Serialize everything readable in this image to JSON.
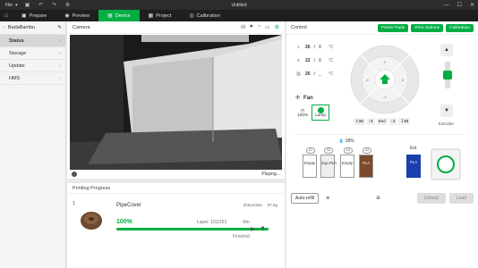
{
  "titlebar": {
    "file_label": "File",
    "window_title": "Untitled"
  },
  "nav": {
    "tabs": [
      {
        "label": "Prepare",
        "active": false
      },
      {
        "label": "Preview",
        "active": false
      },
      {
        "label": "Device",
        "active": true
      },
      {
        "label": "Project",
        "active": false
      },
      {
        "label": "Calibration",
        "active": false
      }
    ]
  },
  "sidebar": {
    "printer_name": "BadaBambu",
    "items": [
      {
        "label": "Status",
        "active": true
      },
      {
        "label": "Storage",
        "active": false
      },
      {
        "label": "Update",
        "active": false
      },
      {
        "label": "HMS",
        "active": false
      }
    ]
  },
  "camera": {
    "title": "Camera",
    "status": "Playing..."
  },
  "progress": {
    "title": "Printing Progress",
    "plate_number": "1",
    "job_name": "PipeCover",
    "time": "2h51m54s",
    "weight": "97.6g",
    "percent_label": "100%",
    "percent_value": 100,
    "layer": "Layer: 151/151",
    "remaining": "-0m",
    "state": "Finished"
  },
  "control": {
    "title": "Control",
    "buttons": [
      "Printer Parts",
      "Print Options",
      "Calibration"
    ],
    "temps": [
      {
        "current": "26",
        "target": "0",
        "unit": "°C"
      },
      {
        "current": "22",
        "target": "0",
        "unit": "°C"
      },
      {
        "current": "26",
        "target": "_",
        "unit": "°C"
      }
    ],
    "fan_label": "Fan",
    "speed_label": "100%",
    "lamp_label": "Lamp",
    "dpad": {
      "up": "Y",
      "down": "-Y",
      "left": "-X",
      "right": "X"
    },
    "z_steps": [
      "10",
      "1",
      "Bed",
      "1",
      "10"
    ],
    "extruder_label": "Extruder",
    "ams": {
      "humidity_label": "18%",
      "slots": [
        {
          "label": "Empty",
          "id": "A1"
        },
        {
          "label": "Sup.PLA",
          "id": "A2",
          "color": "#e8e8e8"
        },
        {
          "label": "Empty",
          "id": "A3"
        },
        {
          "label": "PLA",
          "id": "A4",
          "color": "#7a4a2a"
        }
      ],
      "ext_label": "Ext",
      "ext_slot": {
        "label": "PLA",
        "color": "#1b3fae"
      }
    },
    "auto_refill": "Auto-refill",
    "unload": "Unload",
    "load": "Load"
  }
}
